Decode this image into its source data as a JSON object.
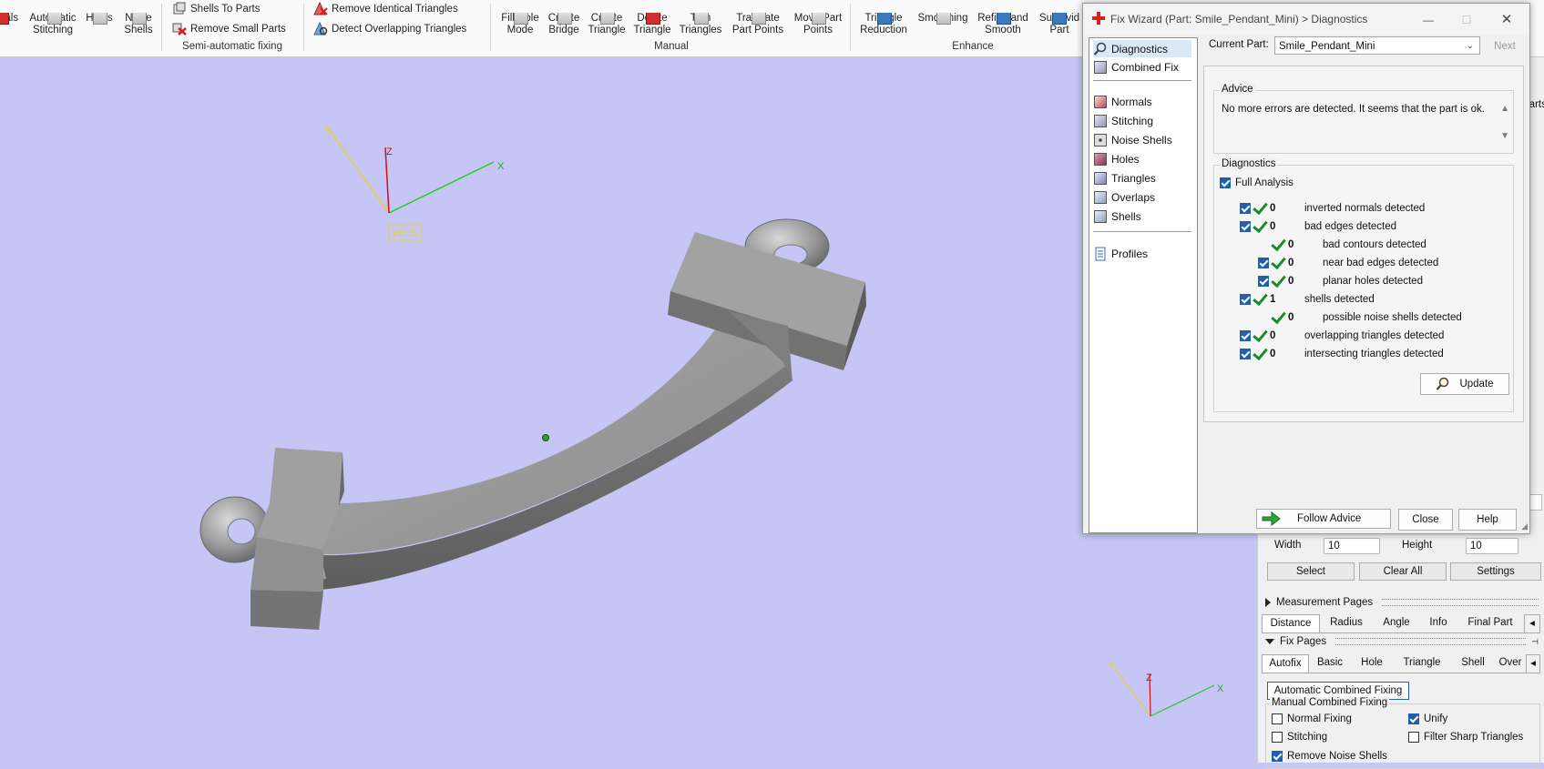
{
  "ribbon": {
    "buttons": [
      {
        "label": "rmals"
      },
      {
        "label": "Automatic\nStitching"
      },
      {
        "label": "Holes"
      },
      {
        "label": "Noise\nShells"
      },
      {
        "label": "Fill Hole\nMode"
      },
      {
        "label": "Create\nBridge"
      },
      {
        "label": "Create\nTriangle"
      },
      {
        "label": "Delete\nTriangle"
      },
      {
        "label": "Trim\nTriangles"
      },
      {
        "label": "Translate\nPart Points"
      },
      {
        "label": "Move Part\nPoints"
      },
      {
        "label": "Triangle\nReduction"
      },
      {
        "label": "Smoothing"
      },
      {
        "label": "Refine and\nSmooth"
      },
      {
        "label": "Subdivid\nPart"
      }
    ],
    "small_buttons": {
      "shells_to_parts": "Shells To Parts",
      "remove_small_parts": "Remove Small Parts",
      "remove_identical": "Remove Identical Triangles",
      "detect_overlapping": "Detect Overlapping Triangles"
    },
    "groups": {
      "semi": "Semi-automatic fixing",
      "manual": "Manual",
      "enhance": "Enhance"
    }
  },
  "viewport": {
    "wcs_label": "WCS",
    "axis_labels": {
      "x": "X",
      "y": "Y",
      "z": "Z"
    }
  },
  "dialog": {
    "title": "Fix Wizard (Part: Smile_Pendant_Mini) > Diagnostics",
    "current_part_label": "Current Part:",
    "current_part_value": "Smile_Pendant_Mini",
    "next_label": "Next",
    "nav_top": [
      {
        "label": "Diagnostics",
        "icon": "magnifier-icon"
      },
      {
        "label": "Combined Fix",
        "icon": "combined-fix-icon"
      }
    ],
    "nav_middle": [
      {
        "label": "Normals",
        "icon": "normals-icon"
      },
      {
        "label": "Stitching",
        "icon": "stitching-icon"
      },
      {
        "label": "Noise Shells",
        "icon": "noise-shells-icon"
      },
      {
        "label": "Holes",
        "icon": "holes-icon"
      },
      {
        "label": "Triangles",
        "icon": "triangles-icon"
      },
      {
        "label": "Overlaps",
        "icon": "overlaps-icon"
      },
      {
        "label": "Shells",
        "icon": "shells-icon"
      }
    ],
    "nav_bottom": [
      {
        "label": "Profiles",
        "icon": "profiles-icon"
      }
    ],
    "advice_title": "Advice",
    "advice_text": "No more errors are detected. It seems that the part is ok.",
    "diagnostics_title": "Diagnostics",
    "full_analysis_label": "Full Analysis",
    "rows": [
      {
        "checkbox": true,
        "value": "0",
        "label": "inverted normals detected",
        "indent": 0
      },
      {
        "checkbox": true,
        "value": "0",
        "label": "bad edges detected",
        "indent": 0
      },
      {
        "checkbox": false,
        "value": "0",
        "label": "bad contours detected",
        "indent": 1
      },
      {
        "checkbox": true,
        "value": "0",
        "label": "near bad edges detected",
        "indent": 1
      },
      {
        "checkbox": true,
        "value": "0",
        "label": "planar holes detected",
        "indent": 1
      },
      {
        "checkbox": true,
        "value": "1",
        "label": "shells detected",
        "indent": 0
      },
      {
        "checkbox": false,
        "value": "0",
        "label": "possible noise shells detected",
        "indent": 1
      },
      {
        "checkbox": true,
        "value": "0",
        "label": "overlapping triangles detected",
        "indent": 0
      },
      {
        "checkbox": true,
        "value": "0",
        "label": "intersecting triangles detected",
        "indent": 0
      }
    ],
    "update_label": "Update",
    "follow_advice_label": "Follow Advice",
    "close_label": "Close",
    "help_label": "Help"
  },
  "right_panel": {
    "partial_labels": {
      "top": "Parts"
    },
    "width_label": "Width",
    "width_value": "10",
    "height_label": "Height",
    "height_value": "10",
    "select_label": "Select",
    "clear_all_label": "Clear All",
    "settings_label": "Settings",
    "measurement_pages_label": "Measurement Pages",
    "measure_tabs": [
      "Distance",
      "Radius",
      "Angle",
      "Info",
      "Final Part"
    ],
    "fix_pages_label": "Fix Pages",
    "fix_tabs": [
      "Autofix",
      "Basic",
      "Hole",
      "Triangle",
      "Shell",
      "Over"
    ],
    "automatic_combined_label": "Automatic Combined Fixing",
    "manual_combined_label": "Manual Combined Fixing",
    "options": [
      {
        "label": "Normal Fixing",
        "checked": false
      },
      {
        "label": "Unify",
        "checked": true
      },
      {
        "label": "Stitching",
        "checked": false
      },
      {
        "label": "Filter Sharp Triangles",
        "checked": false
      },
      {
        "label": "Remove Noise Shells",
        "checked": true
      }
    ]
  },
  "colors": {
    "viewport_bg": "#c5c5f6",
    "model_gray": "#8e8e8e",
    "check_green": "#1a8a2c",
    "checkbox_blue": "#1f5fae",
    "axis_x": "#22cc22",
    "axis_y": "#e3d23a",
    "axis_z": "#cc1111"
  }
}
